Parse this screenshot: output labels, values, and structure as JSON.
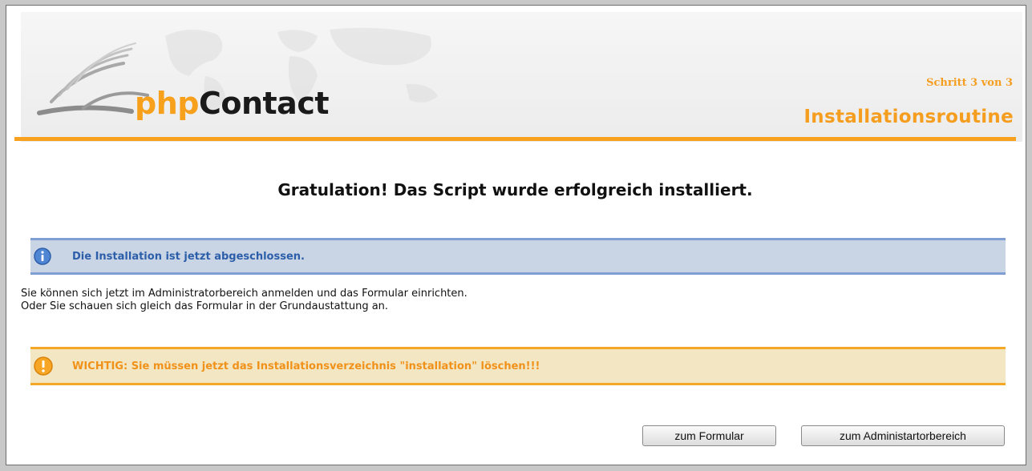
{
  "header": {
    "logo": {
      "part1": "php",
      "part2": "Contact"
    },
    "step": "Schritt 3 von 3",
    "title": "Installationsroutine"
  },
  "main": {
    "headline": "Gratulation! Das Script wurde erfolgreich installiert.",
    "info": {
      "icon": "info-icon",
      "text": "Die Installation ist jetzt abgeschlossen."
    },
    "body_lines": [
      "Sie können sich jetzt im Administratorbereich anmelden und das Formular einrichten.",
      "Oder Sie schauen sich gleich das Formular in der Grundaustattung an."
    ],
    "warning": {
      "icon": "warning-icon",
      "text": "WICHTIG: Sie müssen jetzt das Installationsverzeichnis \"installation\" löschen!!!"
    }
  },
  "buttons": {
    "form_label": "zum Formular",
    "admin_label": "zum Administartorbereich"
  },
  "colors": {
    "accent_orange": "#f7a11e",
    "info_blue": "#2d5eaa",
    "info_bg": "#c9d5e4",
    "warning_bg": "#f3e6c3"
  }
}
